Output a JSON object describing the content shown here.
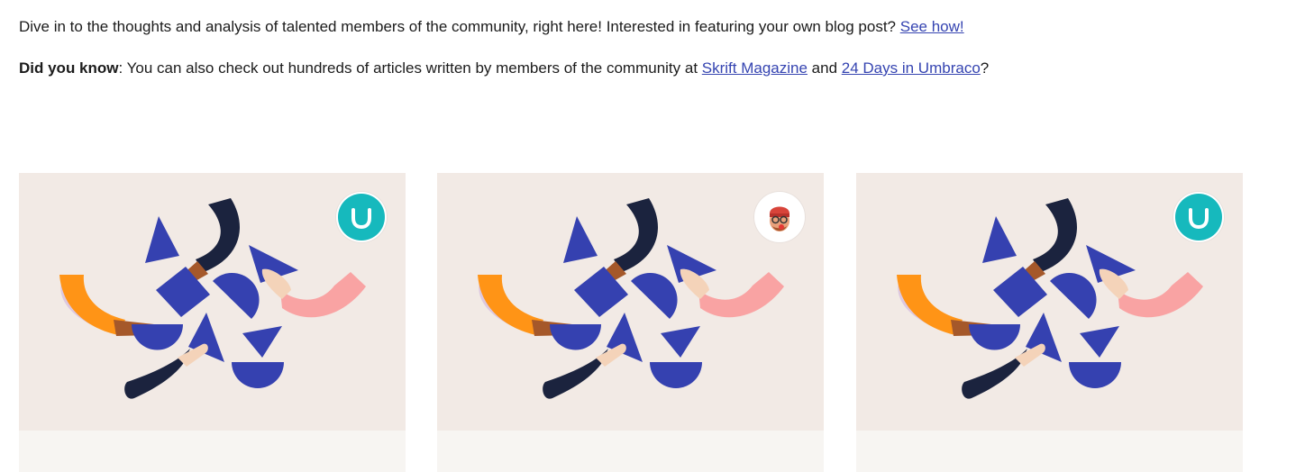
{
  "intro": {
    "line1_text": "Dive in to the thoughts and analysis of talented members of the community, right here! Interested in featuring your own blog post? ",
    "line1_link": "See how!",
    "line2_bold": "Did you know",
    "line2_text": ": You can also check out hundreds of articles written by members of the community at ",
    "line2_link1": "Skrift Magazine",
    "line2_and": " and ",
    "line2_link2": "24 Days in Umbraco",
    "line2_end": "?"
  },
  "cards": [
    {
      "avatar": "umbraco-logo-icon",
      "avatar_color": "#16b9bd"
    },
    {
      "avatar": "user-memoji-avatar",
      "avatar_color": "#ffffff"
    },
    {
      "avatar": "umbraco-logo-icon",
      "avatar_color": "#16b9bd"
    }
  ],
  "colors": {
    "link": "#3544b1",
    "card_thumb_bg": "#f2eae5",
    "card_body_bg": "#f7f5f2",
    "shape_blue": "#3541b0",
    "arm_navy": "#1b233e",
    "arm_orange": "#ff9416",
    "arm_pink": "#f9a3a3",
    "arm_lilac": "#ddc8e0"
  }
}
